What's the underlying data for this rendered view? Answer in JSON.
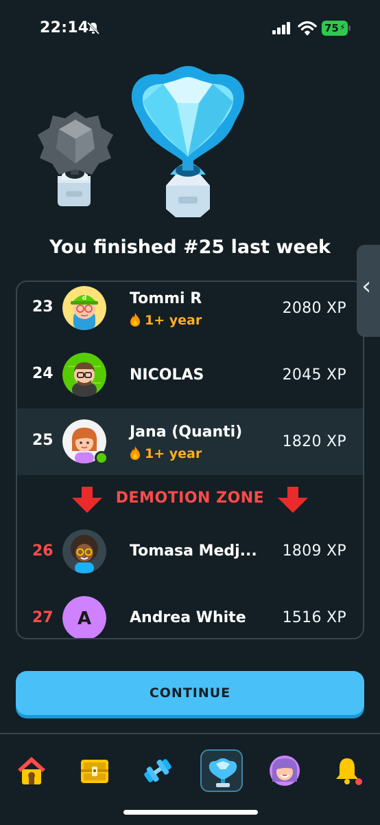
{
  "status_bar": {
    "time": "22:14",
    "battery": "75"
  },
  "heading": "You finished #25 last week",
  "leaderboard": {
    "rows": [
      {
        "rank": "23",
        "name": "Tommi R",
        "streak": "1+ year",
        "xp": "2080 XP"
      },
      {
        "rank": "24",
        "name": "NICOLAS",
        "xp": "2045 XP"
      },
      {
        "rank": "25",
        "name": "Jana (Quanti)",
        "streak": "1+ year",
        "xp": "1820 XP"
      },
      {
        "rank": "26",
        "name": "Tomasa Medj...",
        "xp": "1809 XP"
      },
      {
        "rank": "27",
        "name": "Andrea White",
        "initial": "A",
        "xp": "1516 XP"
      }
    ],
    "demotion_label": "DEMOTION ZONE"
  },
  "continue_label": "CONTINUE",
  "tabs": [
    {
      "icon": "home-icon"
    },
    {
      "icon": "treasure-chest-icon"
    },
    {
      "icon": "dumbbell-icon"
    },
    {
      "icon": "leaderboard-trophy-icon",
      "active": true
    },
    {
      "icon": "profile-avatar-icon"
    },
    {
      "icon": "notification-bell-icon"
    }
  ],
  "colors": {
    "background": "#131f24",
    "accent_blue": "#49c0f8",
    "danger_red": "#ff4b4b",
    "streak_orange": "#ffb020",
    "online_green": "#58cc02"
  }
}
